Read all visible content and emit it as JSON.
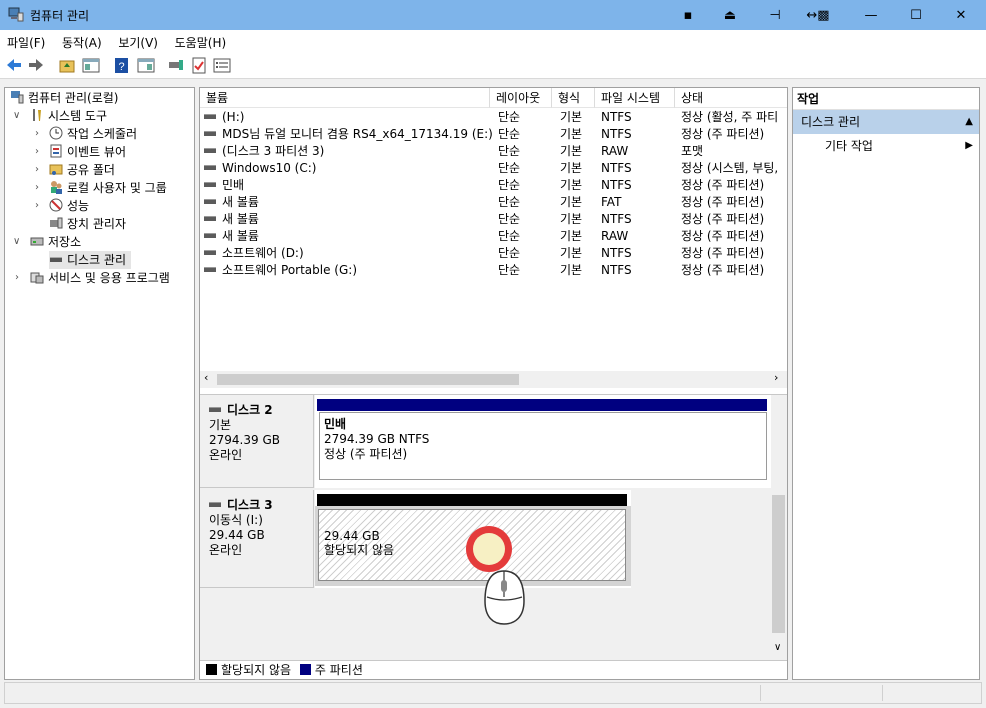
{
  "window": {
    "title": "컴퓨터 관리"
  },
  "menu": [
    "파일(F)",
    "동작(A)",
    "보기(V)",
    "도움말(H)"
  ],
  "tree": {
    "root": "컴퓨터 관리(로컬)",
    "system_tools": "시스템 도구",
    "task_scheduler": "작업 스케줄러",
    "event_viewer": "이벤트 뷰어",
    "shared_folders": "공유 폴더",
    "local_users": "로컬 사용자 및 그룹",
    "performance": "성능",
    "device_manager": "장치 관리자",
    "storage": "저장소",
    "disk_management": "디스크 관리",
    "services_apps": "서비스 및 응용 프로그램"
  },
  "volumes": {
    "columns": [
      "볼륨",
      "레이아웃",
      "형식",
      "파일 시스템",
      "상태"
    ],
    "rows": [
      [
        "(H:)",
        "단순",
        "기본",
        "NTFS",
        "정상 (활성, 주 파티"
      ],
      [
        "MDS님 듀얼 모니터 겸용 RS4_x64_17134.19 (E:)",
        "단순",
        "기본",
        "NTFS",
        "정상 (주 파티션)"
      ],
      [
        "(디스크 3 파티션 3)",
        "단순",
        "기본",
        "RAW",
        "포맷"
      ],
      [
        "Windows10 (C:)",
        "단순",
        "기본",
        "NTFS",
        "정상 (시스템, 부팅,"
      ],
      [
        "민배",
        "단순",
        "기본",
        "NTFS",
        "정상 (주 파티션)"
      ],
      [
        "새 볼륨",
        "단순",
        "기본",
        "FAT",
        "정상 (주 파티션)"
      ],
      [
        "새 볼륨",
        "단순",
        "기본",
        "NTFS",
        "정상 (주 파티션)"
      ],
      [
        "새 볼륨",
        "단순",
        "기본",
        "RAW",
        "정상 (주 파티션)"
      ],
      [
        "소프트웨어 (D:)",
        "단순",
        "기본",
        "NTFS",
        "정상 (주 파티션)"
      ],
      [
        "소프트웨어 Portable (G:)",
        "단순",
        "기본",
        "NTFS",
        "정상 (주 파티션)"
      ]
    ]
  },
  "disks": {
    "disk2": {
      "name": "디스크 2",
      "type": "기본",
      "size": "2794.39 GB",
      "status": "온라인",
      "partition_name": "민배",
      "partition_size": "2794.39 GB NTFS",
      "partition_status": "정상 (주 파티션)"
    },
    "disk3": {
      "name": "디스크 3",
      "type": "이동식 (I:)",
      "size": "29.44 GB",
      "status": "온라인",
      "partition_size": "29.44 GB",
      "partition_status": "할당되지 않음"
    }
  },
  "legend": {
    "unallocated": "할당되지 않음",
    "primary": "주 파티션"
  },
  "actions": {
    "header": "작업",
    "section": "디스크 관리",
    "more": "기타 작업"
  },
  "colors": {
    "titlebar": "#7eb4ea",
    "primary_partition": "#000080",
    "unallocated": "#000000",
    "selection": "#cce8ff",
    "cursor_ring": "#ee4444"
  }
}
